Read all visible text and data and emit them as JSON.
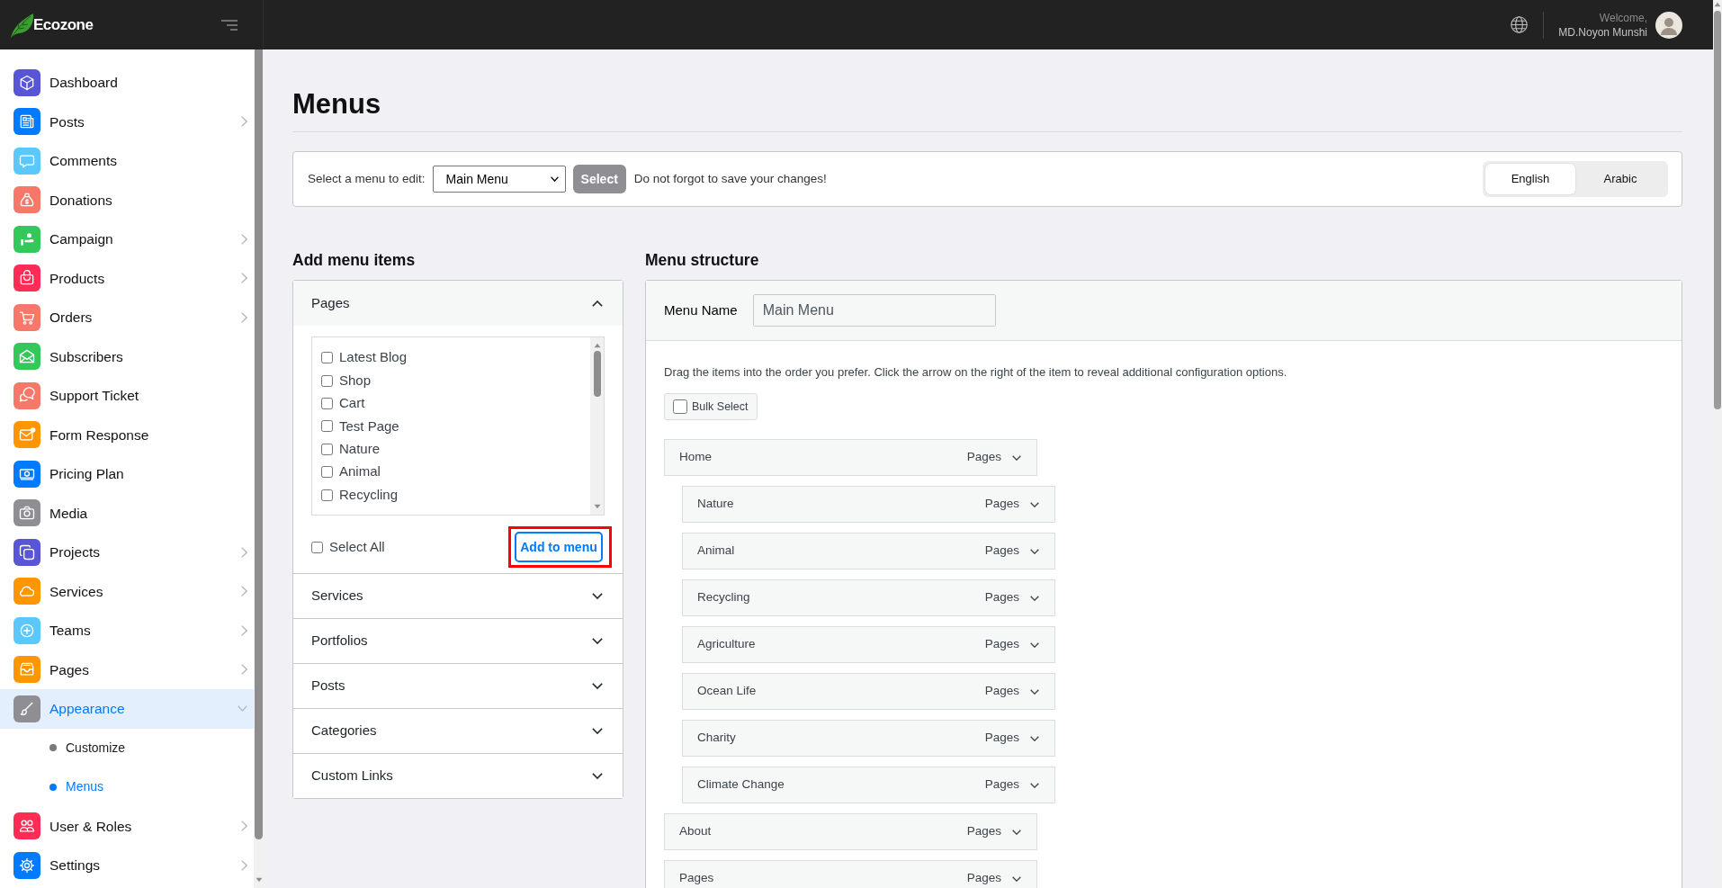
{
  "topbar": {
    "logo_text": "Ecozone",
    "welcome": "Welcome,",
    "user_name": "MD.Noyon Munshi"
  },
  "sidebar": {
    "items": [
      {
        "label": "Dashboard",
        "color": "#5856d6",
        "expandable": false,
        "selected": false
      },
      {
        "label": "Posts",
        "color": "#007aff",
        "expandable": true,
        "expanded": false,
        "selected": false
      },
      {
        "label": "Comments",
        "color": "#5ac8fa",
        "expandable": false,
        "selected": false
      },
      {
        "label": "Donations",
        "color": "#f7786b",
        "expandable": false,
        "selected": false
      },
      {
        "label": "Campaign",
        "color": "#34c759",
        "expandable": true,
        "expanded": false,
        "selected": false
      },
      {
        "label": "Products",
        "color": "#ff2d55",
        "expandable": true,
        "expanded": false,
        "selected": false
      },
      {
        "label": "Orders",
        "color": "#f7786b",
        "expandable": true,
        "expanded": false,
        "selected": false
      },
      {
        "label": "Subscribers",
        "color": "#34c759",
        "expandable": false,
        "selected": false
      },
      {
        "label": "Support Ticket",
        "color": "#f7786b",
        "expandable": false,
        "selected": false
      },
      {
        "label": "Form Response",
        "color": "#ff9500",
        "expandable": false,
        "selected": false
      },
      {
        "label": "Pricing Plan",
        "color": "#007aff",
        "expandable": false,
        "selected": false
      },
      {
        "label": "Media",
        "color": "#8e8e93",
        "expandable": false,
        "selected": false
      },
      {
        "label": "Projects",
        "color": "#5856d6",
        "expandable": true,
        "expanded": false,
        "selected": false
      },
      {
        "label": "Services",
        "color": "#ff9500",
        "expandable": true,
        "expanded": false,
        "selected": false
      },
      {
        "label": "Teams",
        "color": "#5ac8fa",
        "expandable": true,
        "expanded": false,
        "selected": false
      },
      {
        "label": "Pages",
        "color": "#ff9500",
        "expandable": true,
        "expanded": false,
        "selected": false
      },
      {
        "label": "Appearance",
        "color": "#8e8e93",
        "expandable": true,
        "expanded": true,
        "selected": true,
        "children": [
          {
            "label": "Customize",
            "selected": false
          },
          {
            "label": "Menus",
            "selected": true
          }
        ]
      },
      {
        "label": "User & Roles",
        "color": "#ff2d55",
        "expandable": true,
        "expanded": false,
        "selected": false
      },
      {
        "label": "Settings",
        "color": "#007aff",
        "expandable": true,
        "expanded": false,
        "selected": false
      }
    ]
  },
  "page": {
    "title": "Menus"
  },
  "menu_selector": {
    "label": "Select a menu to edit:",
    "value": "Main Menu",
    "button": "Select",
    "note": "Do not forgot to save your changes!"
  },
  "language_tabs": [
    {
      "label": "English",
      "selected": true
    },
    {
      "label": "Arabic",
      "selected": false
    }
  ],
  "add_menu_items": {
    "title": "Add menu items",
    "sections": [
      {
        "label": "Pages",
        "expanded": true,
        "items": [
          {
            "label": "Latest Blog",
            "checked": false
          },
          {
            "label": "Shop",
            "checked": false
          },
          {
            "label": "Cart",
            "checked": false
          },
          {
            "label": "Test Page",
            "checked": false
          },
          {
            "label": "Nature",
            "checked": false
          },
          {
            "label": "Animal",
            "checked": false
          },
          {
            "label": "Recycling",
            "checked": false
          }
        ],
        "select_all": {
          "label": "Select All",
          "checked": false
        },
        "add_button": {
          "label": "Add to menu",
          "highlighted": true
        }
      },
      {
        "label": "Services",
        "expanded": false
      },
      {
        "label": "Portfolios",
        "expanded": false
      },
      {
        "label": "Posts",
        "expanded": false
      },
      {
        "label": "Categories",
        "expanded": false
      },
      {
        "label": "Custom Links",
        "expanded": false
      }
    ]
  },
  "menu_structure": {
    "title": "Menu structure",
    "name_label": "Menu Name",
    "name_value": "Main Menu",
    "instructions": "Drag the items into the order you prefer. Click the arrow on the right of the item to reveal additional configuration options.",
    "bulk_select": {
      "label": "Bulk Select",
      "checked": false
    },
    "items": [
      {
        "label": "Home",
        "type_label": "Pages",
        "children": [
          {
            "label": "Nature",
            "type_label": "Pages"
          },
          {
            "label": "Animal",
            "type_label": "Pages"
          },
          {
            "label": "Recycling",
            "type_label": "Pages"
          },
          {
            "label": "Agriculture",
            "type_label": "Pages"
          },
          {
            "label": "Ocean Life",
            "type_label": "Pages"
          },
          {
            "label": "Charity",
            "type_label": "Pages"
          },
          {
            "label": "Climate Change",
            "type_label": "Pages"
          }
        ]
      },
      {
        "label": "About",
        "type_label": "Pages"
      },
      {
        "label": "Pages",
        "type_label": "Pages"
      }
    ]
  }
}
